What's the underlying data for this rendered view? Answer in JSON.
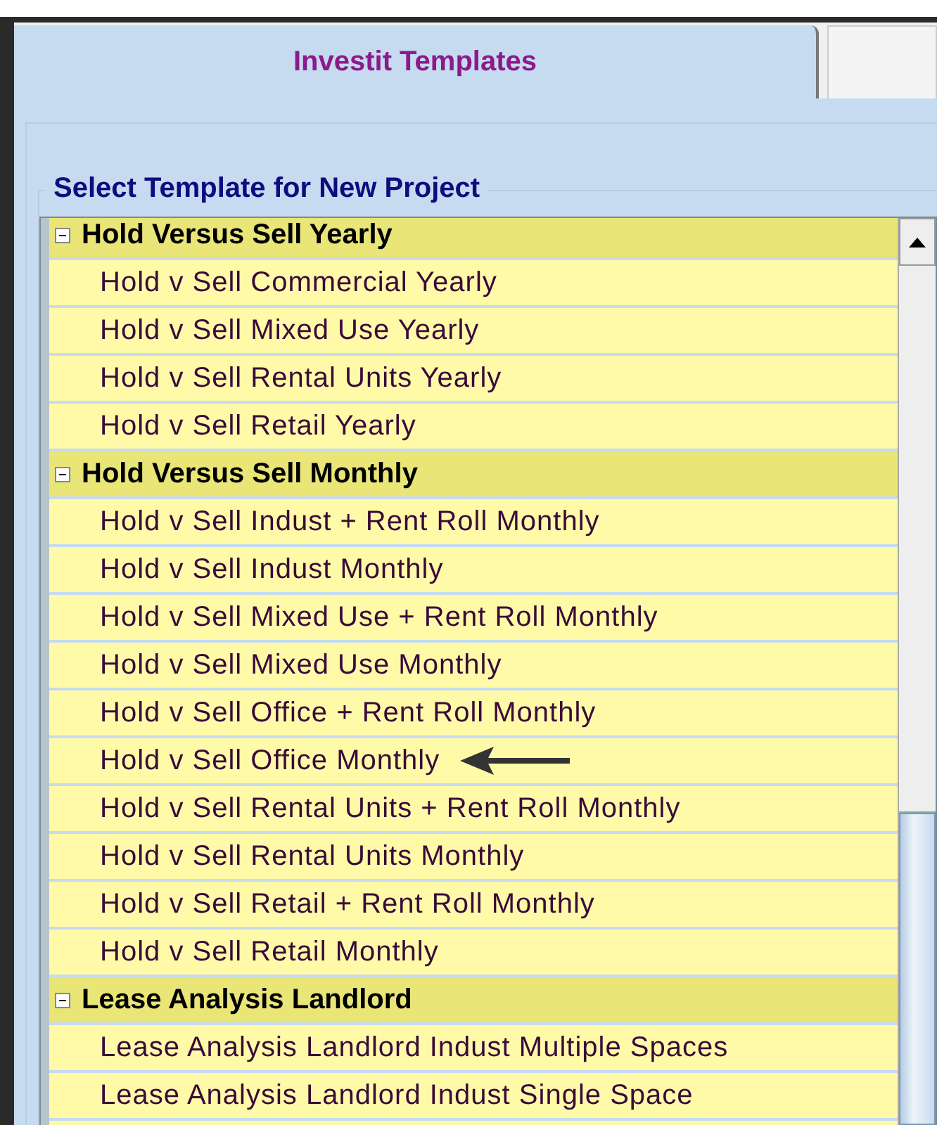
{
  "tabs": [
    {
      "label": "Investit Templates",
      "selected": true
    },
    {
      "selected": false
    }
  ],
  "group_title": "Select Template for New Project",
  "tree": [
    {
      "label": "Hold Versus Sell Yearly",
      "expanded": true,
      "children": [
        {
          "label": "Hold v Sell Commercial Yearly",
          "marked": false
        },
        {
          "label": "Hold v Sell Mixed Use Yearly",
          "marked": false
        },
        {
          "label": "Hold v Sell Rental Units Yearly",
          "marked": false
        },
        {
          "label": "Hold v Sell Retail Yearly",
          "marked": false
        }
      ]
    },
    {
      "label": "Hold Versus Sell Monthly",
      "expanded": true,
      "children": [
        {
          "label": "Hold v Sell Indust + Rent Roll Monthly",
          "marked": false
        },
        {
          "label": "Hold v Sell Indust Monthly",
          "marked": false
        },
        {
          "label": "Hold v Sell Mixed Use + Rent Roll Monthly",
          "marked": false
        },
        {
          "label": "Hold v Sell Mixed Use Monthly",
          "marked": false
        },
        {
          "label": "Hold v Sell Office + Rent Roll Monthly",
          "marked": false
        },
        {
          "label": "Hold v Sell Office Monthly",
          "marked": true
        },
        {
          "label": "Hold v Sell Rental Units + Rent Roll Monthly",
          "marked": false
        },
        {
          "label": "Hold v Sell Rental Units Monthly",
          "marked": false
        },
        {
          "label": "Hold v Sell Retail + Rent Roll Monthly",
          "marked": false
        },
        {
          "label": "Hold v Sell Retail Monthly",
          "marked": false
        }
      ]
    },
    {
      "label": "Lease Analysis Landlord",
      "expanded": true,
      "children": [
        {
          "label": "Lease Analysis Landlord Indust Multiple Spaces",
          "marked": false
        },
        {
          "label": "Lease Analysis Landlord Indust Single Space",
          "marked": false
        }
      ]
    }
  ]
}
